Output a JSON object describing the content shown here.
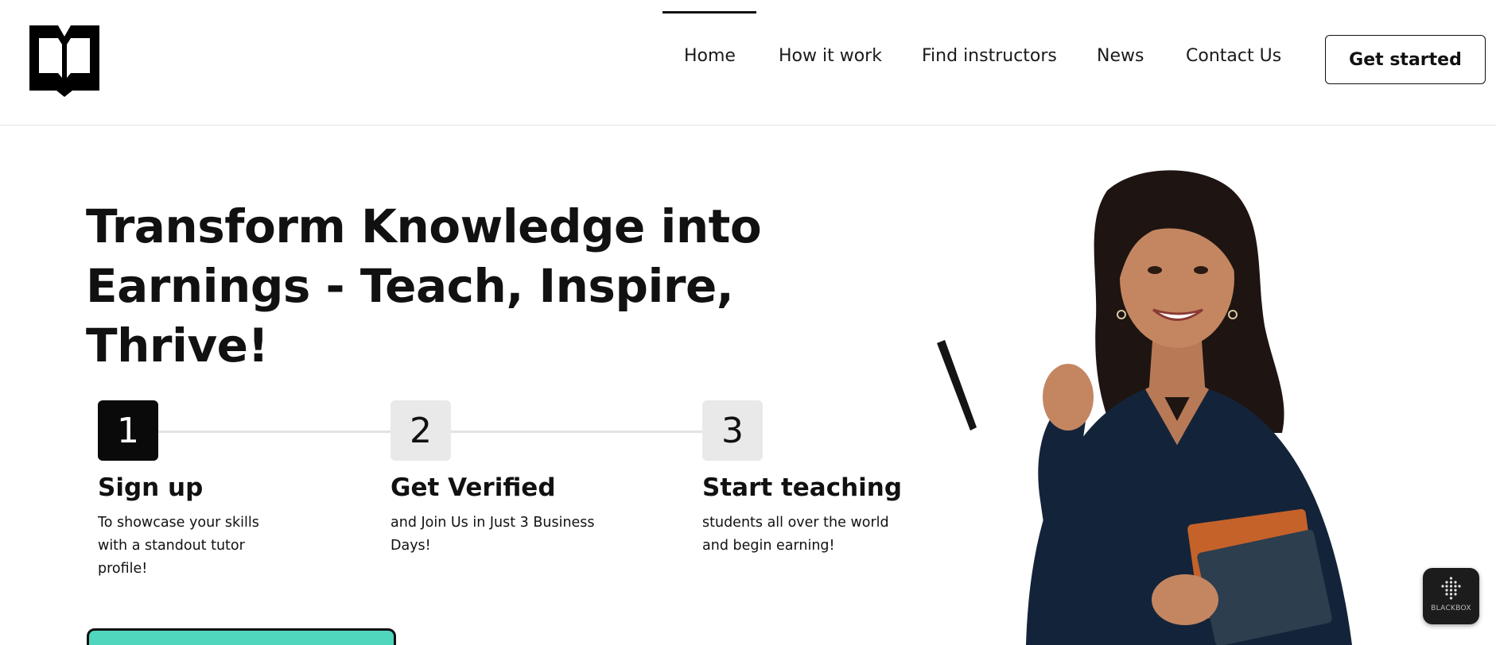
{
  "header": {
    "logo_icon": "open-book-icon",
    "nav": [
      {
        "label": "Home",
        "active": true
      },
      {
        "label": "How it work",
        "active": false
      },
      {
        "label": "Find instructors",
        "active": false
      },
      {
        "label": "News",
        "active": false
      },
      {
        "label": "Contact Us",
        "active": false
      }
    ],
    "cta_label": "Get started"
  },
  "hero": {
    "title_line1": "Transform Knowledge into",
    "title_line2": "Earnings - Teach, Inspire, Thrive!",
    "steps": [
      {
        "number": "1",
        "title": "Sign up",
        "desc_lines": [
          "To showcase your skills",
          "with a standout tutor",
          "profile!"
        ],
        "active": true
      },
      {
        "number": "2",
        "title": "Get Verified",
        "desc_lines": [
          "and Join Us in Just 3 Business",
          "Days!"
        ],
        "active": false
      },
      {
        "number": "3",
        "title": "Start teaching",
        "desc_lines": [
          "students all over the world",
          "and begin earning!"
        ],
        "active": false
      }
    ],
    "button_color": "#4fd6bd"
  },
  "widget": {
    "label": "BLACKBOX",
    "icon": "dot-grid-icon"
  },
  "colors": {
    "accent": "#4fd6bd",
    "text": "#111111",
    "step_inactive_bg": "#e9e9e9"
  }
}
